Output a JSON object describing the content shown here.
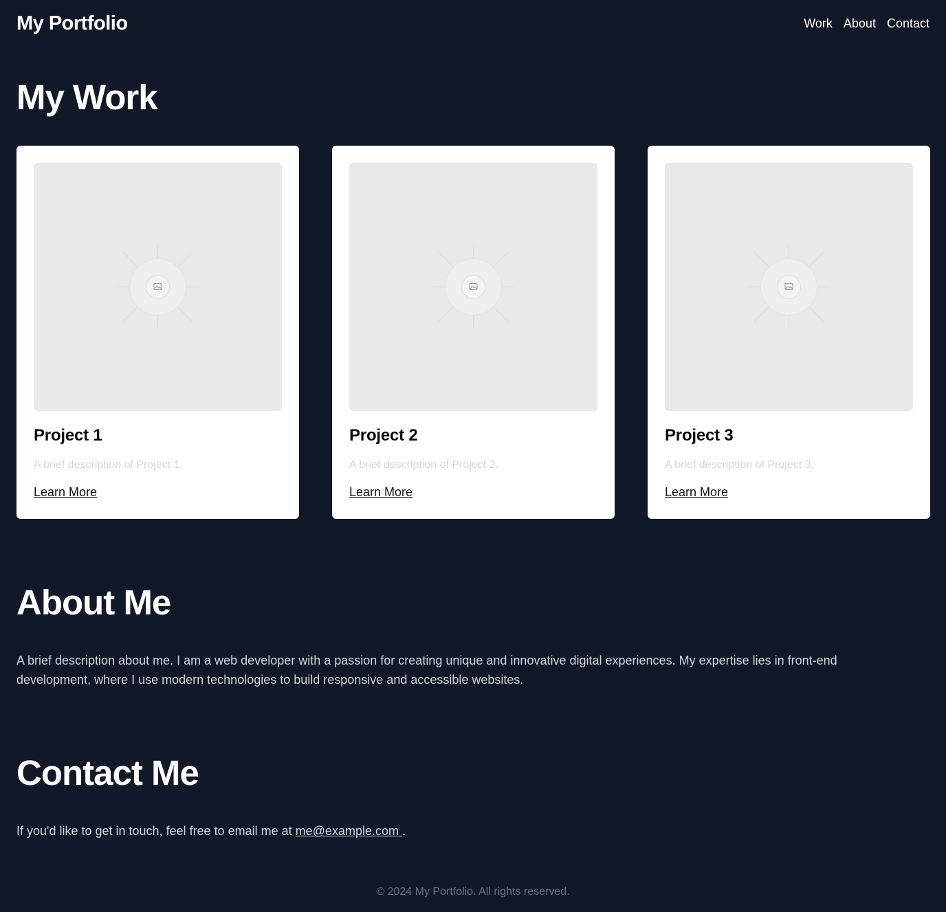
{
  "header": {
    "brand": "My Portfolio",
    "nav": [
      "Work",
      "About",
      "Contact"
    ]
  },
  "work": {
    "heading": "My Work",
    "projects": [
      {
        "title": "Project 1",
        "description": "A brief description of Project 1.",
        "link": "Learn More",
        "image_icon": "image-placeholder-icon"
      },
      {
        "title": "Project 2",
        "description": "A brief description of Project 2.",
        "link": "Learn More",
        "image_icon": "image-placeholder-icon"
      },
      {
        "title": "Project 3",
        "description": "A brief description of Project 3.",
        "link": "Learn More",
        "image_icon": "image-placeholder-icon"
      }
    ]
  },
  "about": {
    "heading": "About Me",
    "text": "A brief description about me. I am a web developer with a passion for creating unique and innovative digital experiences. My expertise lies in front-end development, where I use modern technologies to build responsive and accessible websites."
  },
  "contact": {
    "heading": "Contact Me",
    "text_before": "If you'd like to get in touch, feel free to email me at ",
    "email": "me@example.com ",
    "text_after": "."
  },
  "footer": {
    "text": "© 2024 My Portfolio. All rights reserved."
  },
  "colors": {
    "background": "#111827",
    "card": "#ffffff",
    "placeholder": "#e9e9e9",
    "muted_text": "#d1d5db",
    "footer_text": "#6b7280"
  }
}
